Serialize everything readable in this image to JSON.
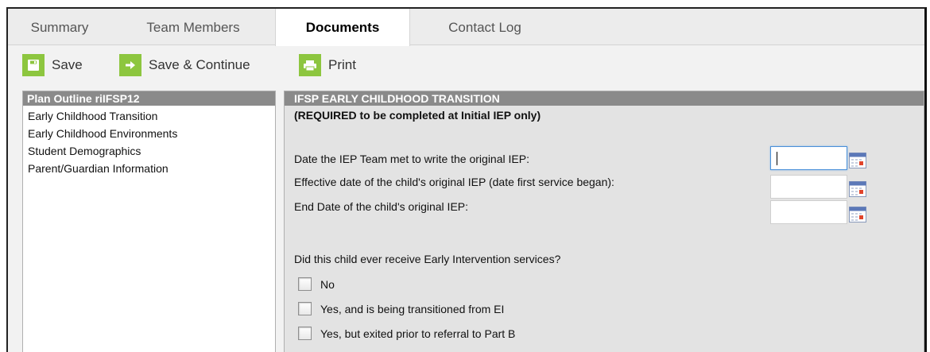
{
  "tabs": [
    {
      "label": "Summary"
    },
    {
      "label": "Team Members"
    },
    {
      "label": "Documents",
      "active": true
    },
    {
      "label": "Contact Log"
    }
  ],
  "toolbar": {
    "save_label": "Save",
    "save_continue_label": "Save & Continue",
    "print_label": "Print",
    "accent": "#8dc63f"
  },
  "outline": {
    "title": "Plan Outline riIFSP12",
    "items": [
      {
        "label": "Early Childhood Transition"
      },
      {
        "label": "Early Childhood Environments"
      },
      {
        "label": "Student Demographics"
      },
      {
        "label": "Parent/Guardian Information"
      }
    ]
  },
  "form": {
    "title": "IFSP EARLY CHILDHOOD TRANSITION",
    "subtitle": "(REQUIRED to be completed at Initial IEP only)",
    "fields": [
      {
        "label": "Date the IEP Team met to write the original IEP:",
        "value": ""
      },
      {
        "label": "Effective date of the child's original IEP (date first service began):",
        "value": ""
      },
      {
        "label": "End Date of the child's original IEP:",
        "value": ""
      }
    ],
    "question": "Did this child ever receive Early Intervention services?",
    "options": [
      {
        "label": "No",
        "checked": false
      },
      {
        "label": "Yes, and is being transitioned from EI",
        "checked": false
      },
      {
        "label": "Yes, but exited prior to referral to Part B",
        "checked": false
      }
    ]
  }
}
